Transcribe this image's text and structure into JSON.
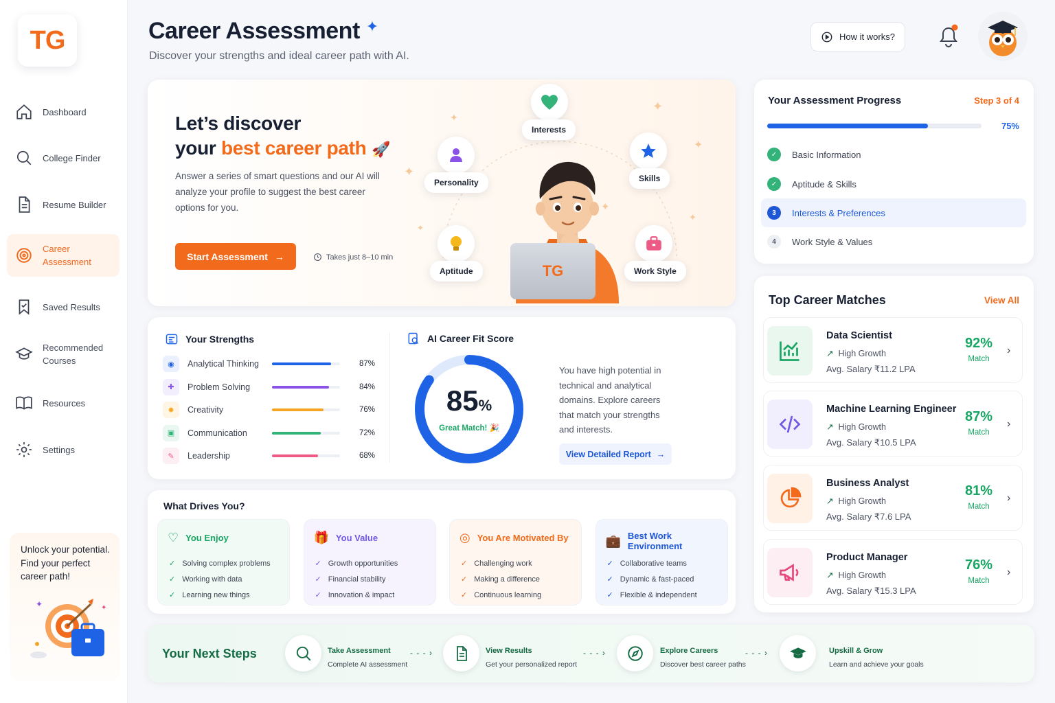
{
  "brand": {
    "logo_text": "TG",
    "accent": "#f26a1b",
    "primary": "#1e63e6",
    "success": "#18a664"
  },
  "sidebar": {
    "items": [
      {
        "label": "Dashboard",
        "icon": "home-icon"
      },
      {
        "label": "College Finder",
        "icon": "search-icon"
      },
      {
        "label": "Resume Builder",
        "icon": "document-icon"
      },
      {
        "label": "Career\nAssessment",
        "icon": "target-icon",
        "active": true
      },
      {
        "label": "Saved Results",
        "icon": "bookmark-icon"
      },
      {
        "label": "Recommended\nCourses",
        "icon": "graduation-cap-icon"
      },
      {
        "label": "Resources",
        "icon": "book-icon"
      },
      {
        "label": "Settings",
        "icon": "gear-icon"
      }
    ],
    "promo_text": "Unlock your potential. Find your perfect career path!"
  },
  "header": {
    "title": "Career Assessment",
    "subtitle": "Discover your strengths and ideal career path with AI.",
    "how_button": "How it works?"
  },
  "hero": {
    "title_line1": "Let’s discover",
    "title_prefix": "your ",
    "title_highlight": "best career path",
    "description": "Answer a series of smart questions and our AI will analyze your profile to suggest the best career options for you.",
    "start_button": "Start Assessment",
    "duration": "Takes just 8–10 min",
    "laptop_text": "TG",
    "bubbles": {
      "interests": "Interests",
      "personality": "Personality",
      "skills": "Skills",
      "aptitude": "Aptitude",
      "work_style": "Work Style"
    }
  },
  "progress": {
    "title": "Your Assessment Progress",
    "step": "Step 3 of 4",
    "percent_label": "75%",
    "percent": 0.75,
    "steps": [
      {
        "label": "Basic Information",
        "state": "done"
      },
      {
        "label": "Aptitude & Skills",
        "state": "done"
      },
      {
        "label": "Interests & Preferences",
        "state": "current",
        "num": "3"
      },
      {
        "label": "Work Style & Values",
        "state": "pending",
        "num": "4"
      }
    ]
  },
  "matches": {
    "title": "Top Career Matches",
    "view_all": "View All",
    "items": [
      {
        "name": "Data Scientist",
        "growth": "High Growth",
        "salary": "Avg. Salary  ₹11.2 LPA",
        "pct": "92%",
        "match": "Match",
        "icon": "bar-chart-icon",
        "color": "#18a664",
        "bg": "#eaf7ef"
      },
      {
        "name": "Machine Learning Engineer",
        "growth": "High Growth",
        "salary": "Avg. Salary  ₹10.5 LPA",
        "pct": "87%",
        "match": "Match",
        "icon": "code-icon",
        "color": "#7357e6",
        "bg": "#f1eefd"
      },
      {
        "name": "Business Analyst",
        "growth": "High Growth",
        "salary": "Avg. Salary  ₹7.6 LPA",
        "pct": "81%",
        "match": "Match",
        "icon": "pie-chart-icon",
        "color": "#f26a1b",
        "bg": "#fff1e6"
      },
      {
        "name": "Product Manager",
        "growth": "High Growth",
        "salary": "Avg. Salary  ₹15.3 LPA",
        "pct": "76%",
        "match": "Match",
        "icon": "megaphone-icon",
        "color": "#e5487a",
        "bg": "#fdeef3"
      }
    ]
  },
  "strengths": {
    "title": "Your Strengths",
    "items": [
      {
        "label": "Analytical Thinking",
        "value": "87%",
        "fraction": 0.87,
        "color": "#1e63e6",
        "icon": "brain-icon",
        "bg": "#eaf0fd"
      },
      {
        "label": "Problem Solving",
        "value": "84%",
        "fraction": 0.84,
        "color": "#8a52e6",
        "icon": "puzzle-icon",
        "bg": "#f3eefd"
      },
      {
        "label": "Creativity",
        "value": "76%",
        "fraction": 0.76,
        "color": "#f5a524",
        "icon": "lightbulb-icon",
        "bg": "#fff5e4"
      },
      {
        "label": "Communication",
        "value": "72%",
        "fraction": 0.72,
        "color": "#33b27a",
        "icon": "chat-icon",
        "bg": "#e9f7f0"
      },
      {
        "label": "Leadership",
        "value": "68%",
        "fraction": 0.68,
        "color": "#ee5a86",
        "icon": "flag-icon",
        "bg": "#fdeef3"
      }
    ]
  },
  "fit": {
    "title": "AI Career Fit Score",
    "score": "85",
    "unit": "%",
    "score_fraction": 0.85,
    "label": "Great Match! 🎉",
    "description": "You have high potential in technical and analytical domains. Explore careers that match your strengths and interests.",
    "report_button": "View Detailed Report"
  },
  "drives": {
    "title": "What Drives You?",
    "cards": [
      {
        "title": "You Enjoy",
        "color": "#18a664",
        "bg": "#f1faf5",
        "icon": "heart-icon",
        "items": [
          "Solving complex problems",
          "Working with data",
          "Learning new things"
        ]
      },
      {
        "title": "You Value",
        "color": "#7357e6",
        "bg": "#f6f3fe",
        "icon": "gift-icon",
        "items": [
          "Growth opportunities",
          "Financial stability",
          "Innovation & impact"
        ]
      },
      {
        "title": "You Are Motivated By",
        "color": "#f26a1b",
        "bg": "#fff7ef",
        "icon": "target-icon",
        "items": [
          "Challenging work",
          "Making a difference",
          "Continuous learning"
        ]
      },
      {
        "title": "Best Work Environment",
        "color": "#1e57d6",
        "bg": "#f1f5fe",
        "icon": "briefcase-icon",
        "items": [
          "Collaborative teams",
          "Dynamic & fast-paced",
          "Flexible & independent"
        ]
      }
    ]
  },
  "next_steps": {
    "title": "Your Next Steps",
    "items": [
      {
        "label": "Take Assessment",
        "desc": "Complete AI assessment",
        "icon": "search-icon"
      },
      {
        "label": "View Results",
        "desc": "Get your personalized report",
        "icon": "document-icon"
      },
      {
        "label": "Explore Careers",
        "desc": "Discover best career paths",
        "icon": "compass-icon"
      },
      {
        "label": "Upskill & Grow",
        "desc": "Learn and achieve your goals",
        "icon": "graduation-cap-icon"
      }
    ]
  }
}
